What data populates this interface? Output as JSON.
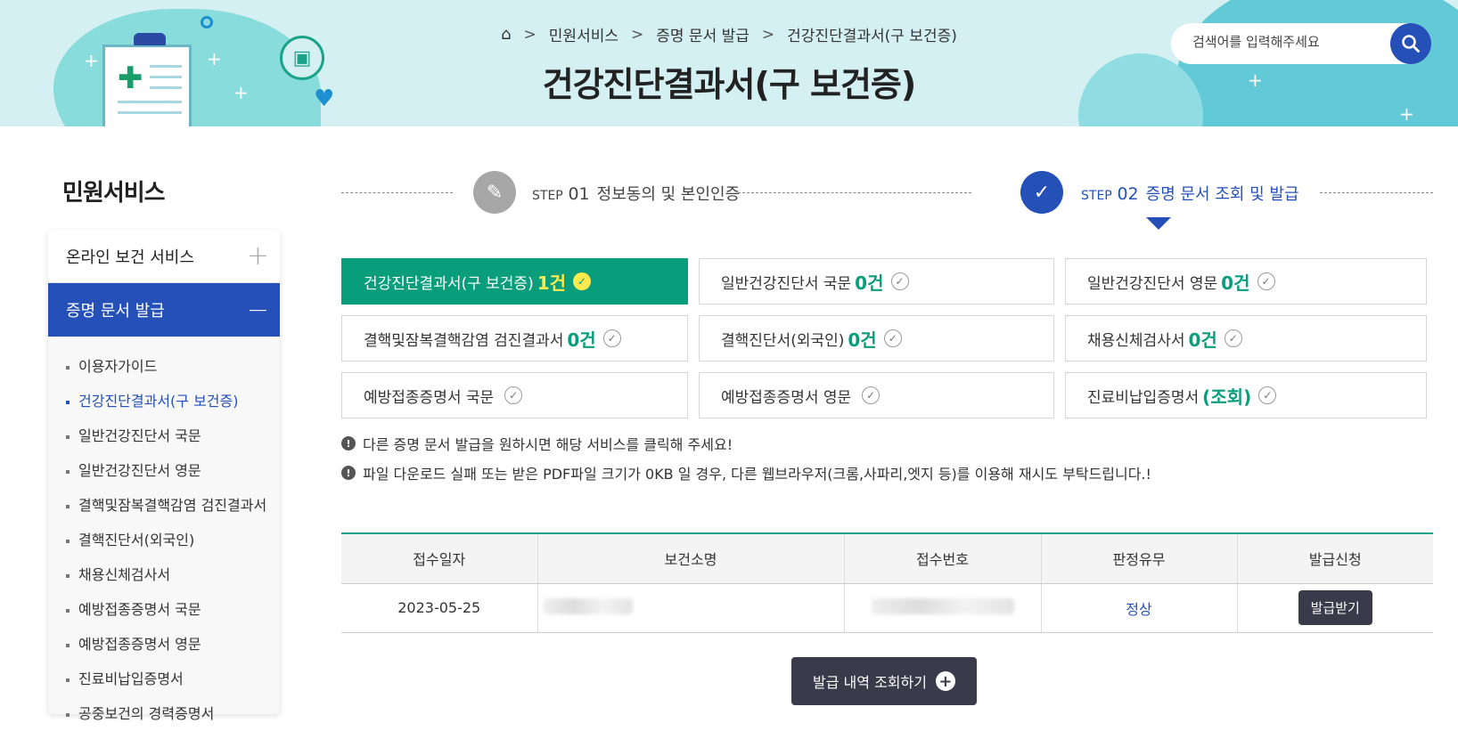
{
  "breadcrumb": {
    "items": [
      "민원서비스",
      "증명 문서 발급",
      "건강진단결과서(구 보건증)"
    ],
    "sep": ">"
  },
  "page_title": "건강진단결과서(구 보건증)",
  "search": {
    "placeholder": "검색어를 입력해주세요"
  },
  "sidebar": {
    "title": "민원서비스",
    "sections": [
      {
        "label": "온라인 보건 서비스",
        "symbol": "+"
      },
      {
        "label": "증명 문서 발급",
        "symbol": "−"
      }
    ],
    "items": [
      "이용자가이드",
      "건강진단결과서(구 보건증)",
      "일반건강진단서 국문",
      "일반건강진단서 영문",
      "결핵및잠복결핵감염 검진결과서",
      "결핵진단서(외국인)",
      "채용신체검사서",
      "예방접종증명서 국문",
      "예방접종증명서 영문",
      "진료비납입증명서",
      "공중보건의 경력증명서"
    ]
  },
  "steps": [
    {
      "label": "STEP",
      "num": "01",
      "text": "정보동의 및 본인인증"
    },
    {
      "label": "STEP",
      "num": "02",
      "text": "증명 문서 조회 및 발급"
    }
  ],
  "doc_cards": [
    {
      "name": "건강진단결과서(구 보건증)",
      "count": "1건"
    },
    {
      "name": "일반건강진단서 국문",
      "count": "0건"
    },
    {
      "name": "일반건강진단서 영문",
      "count": "0건"
    },
    {
      "name": "결핵및잠복결핵감염 검진결과서",
      "count": "0건"
    },
    {
      "name": "결핵진단서(외국인)",
      "count": "0건"
    },
    {
      "name": "채용신체검사서",
      "count": "0건"
    },
    {
      "name": "예방접종증명서 국문",
      "count": ""
    },
    {
      "name": "예방접종증명서 영문",
      "count": ""
    },
    {
      "name": "진료비납입증명서",
      "count": "(조회)"
    }
  ],
  "notices": [
    "다른 증명 문서 발급을 원하시면 해당 서비스를 클릭해 주세요!",
    "파일 다운로드 실패 또는 받은 PDF파일 크기가 0KB 일 경우, 다른 웹브라우저(크롬,사파리,엣지 등)를 이용해 재시도 부탁드립니다.!"
  ],
  "table": {
    "headers": [
      "접수일자",
      "보건소명",
      "접수번호",
      "판정유무",
      "발급신청"
    ],
    "rows": [
      {
        "date": "2023-05-25",
        "result": "정상",
        "action": "발급받기"
      }
    ]
  },
  "more_button": "발급 내역 조회하기"
}
